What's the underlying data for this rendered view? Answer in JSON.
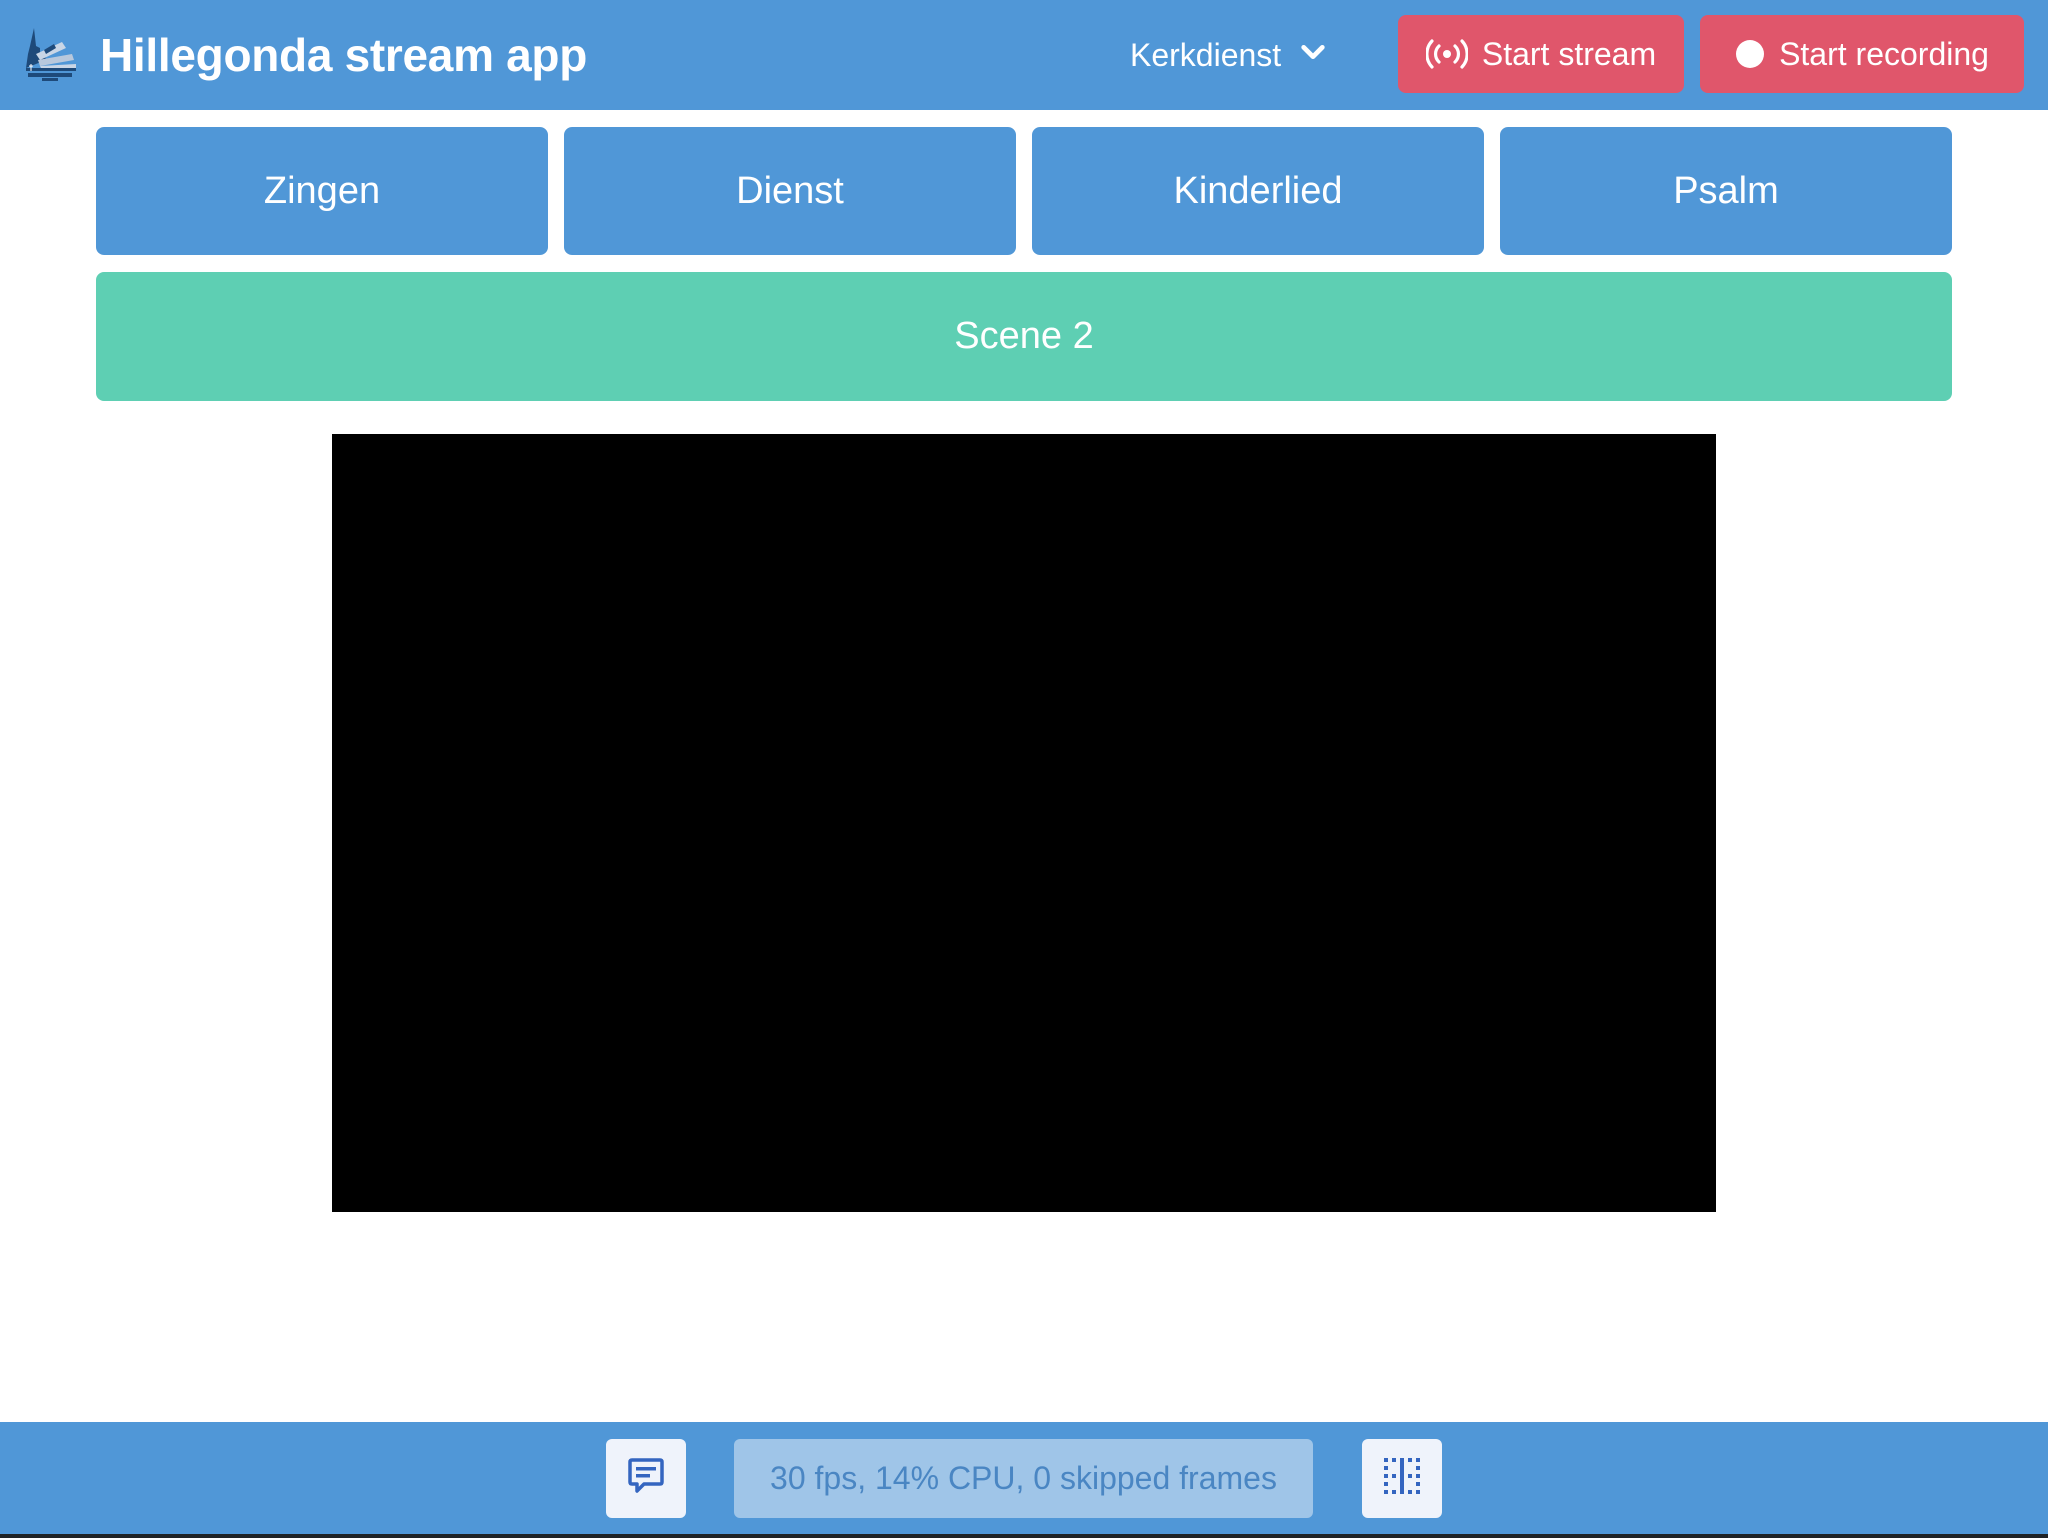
{
  "header": {
    "logo_alt": "Hillegonda Kerk logo",
    "title": "Hillegonda stream app",
    "profile": {
      "selected": "Kerkdienst",
      "icon": "chevron-down-icon"
    },
    "stream_button": {
      "label": "Start stream",
      "icon": "broadcast-icon"
    },
    "record_button": {
      "label": "Start recording",
      "icon": "record-dot-icon"
    }
  },
  "scenes": {
    "buttons": [
      {
        "label": "Zingen"
      },
      {
        "label": "Dienst"
      },
      {
        "label": "Kinderlied"
      },
      {
        "label": "Psalm"
      }
    ],
    "active": {
      "label": "Scene 2"
    }
  },
  "footer": {
    "chat_button": {
      "icon": "chat-icon"
    },
    "status_text": "30 fps, 14% CPU, 0 skipped frames",
    "columns_button": {
      "icon": "columns-icon"
    }
  },
  "colors": {
    "primary": "#5097d7",
    "danger": "#e0566b",
    "success": "#5ecfb3",
    "status_bg": "#9fc5e8",
    "status_text": "#4a86c3",
    "icon_blue": "#3465c0"
  }
}
